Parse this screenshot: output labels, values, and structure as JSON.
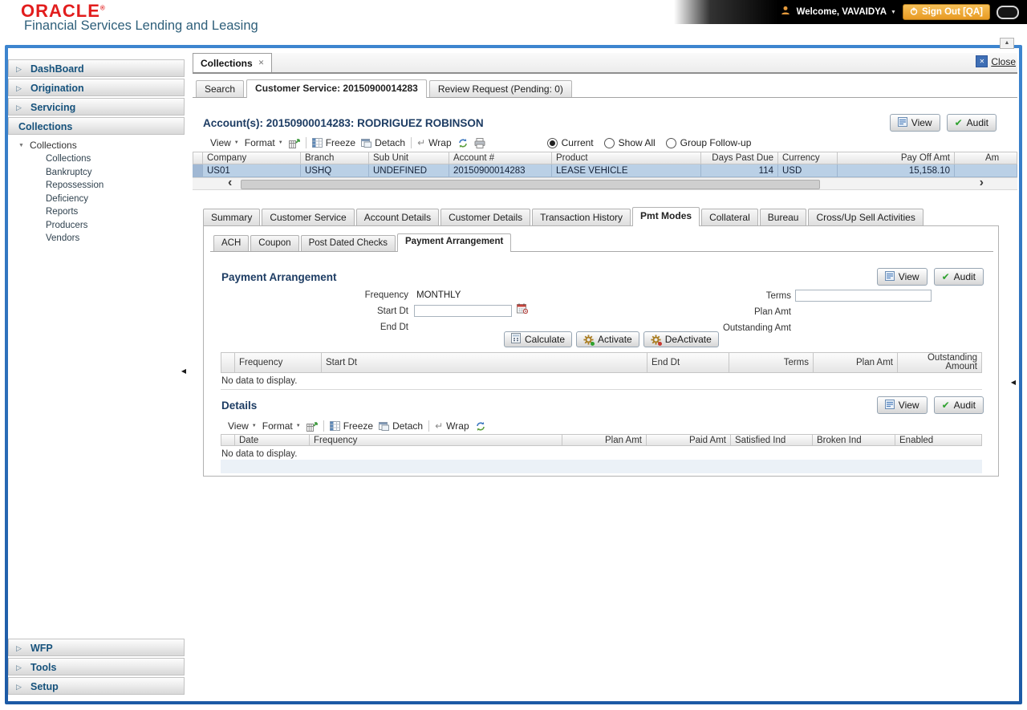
{
  "header": {
    "logo": "ORACLE",
    "logo_mark": "®",
    "subtitle": "Financial Services Lending and Leasing",
    "welcome": "Welcome, VAVAIDYA",
    "sign_out": "Sign Out [QA]"
  },
  "sidebar": {
    "items": [
      "DashBoard",
      "Origination",
      "Servicing",
      "Collections"
    ],
    "tree_root": "Collections",
    "tree_children": [
      "Collections",
      "Bankruptcy",
      "Repossession",
      "Deficiency",
      "Reports",
      "Producers",
      "Vendors"
    ],
    "items_bottom": [
      "WFP",
      "Tools",
      "Setup"
    ]
  },
  "workspace": {
    "doc_tab": "Collections",
    "close_label": "Close",
    "subtabs": [
      "Search",
      "Customer Service: 20150900014283",
      "Review Request (Pending: 0)"
    ],
    "account_title": "Account(s): 20150900014283: RODRIGUEZ ROBINSON",
    "buttons": {
      "view": "View",
      "audit": "Audit"
    },
    "toolbar": {
      "view": "View",
      "format": "Format",
      "freeze": "Freeze",
      "detach": "Detach",
      "wrap": "Wrap"
    },
    "filters": {
      "current": "Current",
      "show_all": "Show All",
      "group_follow_up": "Group Follow-up"
    },
    "account_grid": {
      "columns": [
        "Company",
        "Branch",
        "Sub Unit",
        "Account #",
        "Product",
        "Days Past Due",
        "Currency",
        "Pay Off Amt",
        "Am"
      ],
      "row": [
        "US01",
        "USHQ",
        "UNDEFINED",
        "20150900014283",
        "LEASE VEHICLE",
        "114",
        "USD",
        "15,158.10"
      ]
    },
    "tabs": [
      "Summary",
      "Customer Service",
      "Account Details",
      "Customer Details",
      "Transaction History",
      "Pmt Modes",
      "Collateral",
      "Bureau",
      "Cross/Up Sell Activities"
    ],
    "pmt_subtabs": [
      "ACH",
      "Coupon",
      "Post Dated Checks",
      "Payment Arrangement"
    ],
    "payment_arrangement": {
      "title": "Payment Arrangement",
      "labels": {
        "frequency": "Frequency",
        "start_dt": "Start Dt",
        "end_dt": "End Dt",
        "terms": "Terms",
        "plan_amt": "Plan Amt",
        "outstanding_amt": "Outstanding Amt"
      },
      "values": {
        "frequency": "MONTHLY",
        "start_dt": "",
        "terms": ""
      },
      "actions": [
        "Calculate",
        "Activate",
        "DeActivate"
      ],
      "grid": {
        "columns": [
          "Frequency",
          "Start Dt",
          "End Dt",
          "Terms",
          "Plan Amt",
          "Outstanding Amount"
        ],
        "empty": "No data to display."
      }
    },
    "details": {
      "title": "Details",
      "grid": {
        "columns": [
          "Date",
          "Frequency",
          "Plan Amt",
          "Paid Amt",
          "Satisfied Ind",
          "Broken Ind",
          "Enabled"
        ],
        "empty": "No data to display."
      }
    }
  },
  "icons": {
    "caret_down": "▼",
    "nav_arrow": "▷",
    "tree_open": "▼",
    "close_x": "✕",
    "wrap_arrow": "↵",
    "scroll_left": "‹",
    "scroll_right": "›",
    "collapse_left": "◀",
    "scroll_up": "▲",
    "audit_check": "✔",
    "welcome_caret": "▼"
  },
  "colors": {
    "oracle_red": "#e21d1d",
    "brand_teal": "#2e5f7a",
    "frame_blue": "#2368b6",
    "title_navy": "#1d3c63",
    "selected_row": "#bad0e6",
    "signout_orange": "#e89a22"
  }
}
